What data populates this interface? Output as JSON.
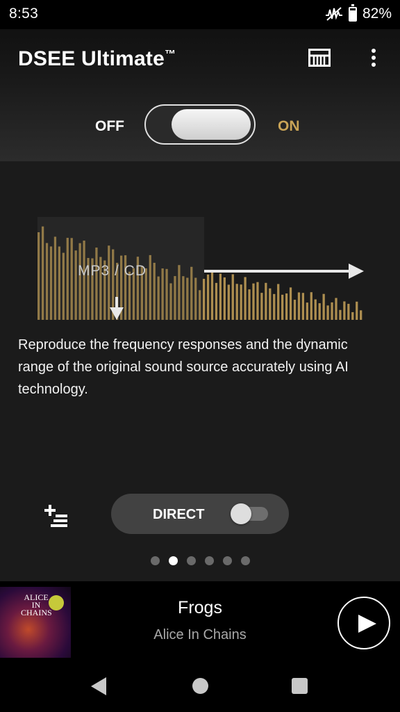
{
  "status": {
    "time": "8:53",
    "battery": "82%",
    "battery_level": 0.82,
    "icons": [
      "hi-res-icon",
      "battery-icon"
    ]
  },
  "header": {
    "title": "DSEE Ultimate",
    "title_mark": "™",
    "icons": [
      "equalizer-icon",
      "more-vert-icon"
    ]
  },
  "switch": {
    "off_label": "OFF",
    "on_label": "ON",
    "state": "on"
  },
  "illustration": {
    "source_label": "MP3 / CD",
    "accent_color": "#b59553"
  },
  "description": "Reproduce the frequency responses and the dynamic range of the original sound source accurately using AI technology.",
  "controls": {
    "direct_label": "DIRECT",
    "direct_state": "off",
    "add_icon": "add-to-queue-icon"
  },
  "pager": {
    "count": 6,
    "active_index": 1
  },
  "player": {
    "track": "Frogs",
    "artist": "Alice In Chains",
    "album_text": "ALICE IN CHAINS",
    "play_icon": "play-icon"
  },
  "nav": [
    "back-icon",
    "home-icon",
    "recents-icon"
  ]
}
